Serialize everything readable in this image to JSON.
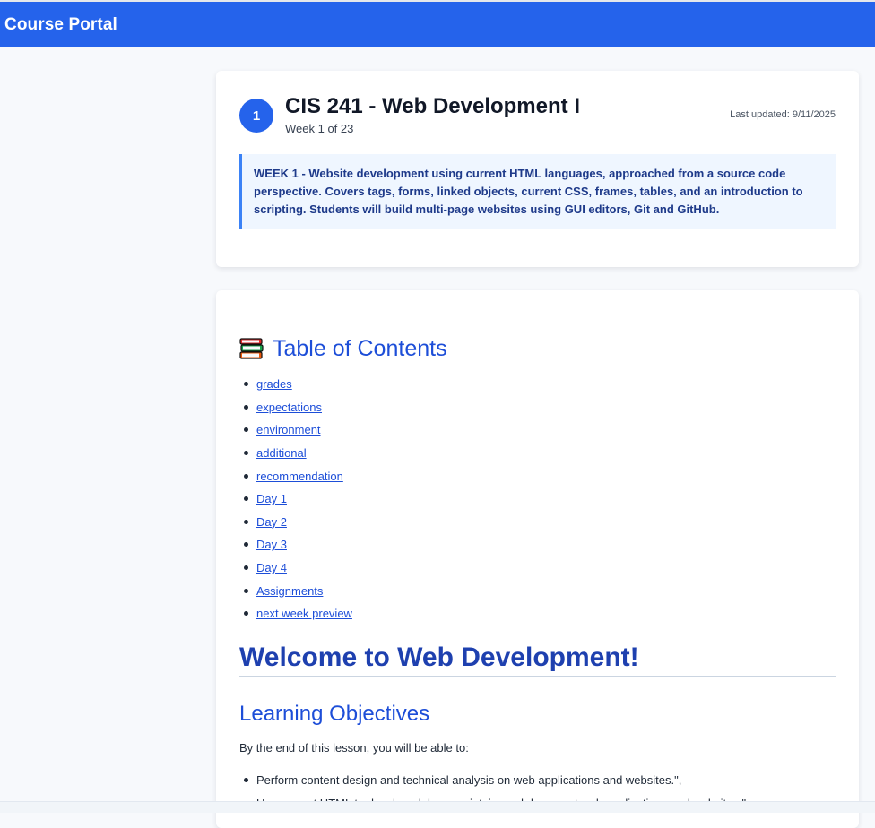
{
  "app": {
    "title": "Course Portal"
  },
  "course": {
    "week_number": "1",
    "title": "CIS 241 - Web Development I",
    "week_label": "Week 1 of 23",
    "last_updated": "Last updated: 9/11/2025",
    "description": "WEEK 1 - Website development using current HTML languages, approached from a source code perspective. Covers tags, forms, linked objects, current CSS, frames, tables, and an introduction to scripting. Students will build multi-page websites using GUI editors, Git and GitHub."
  },
  "toc": {
    "heading": "Table of Contents",
    "icon": "books-icon",
    "items": [
      {
        "label": "grades"
      },
      {
        "label": "expectations"
      },
      {
        "label": "environment"
      },
      {
        "label": "additional"
      },
      {
        "label": "recommendation"
      },
      {
        "label": "Day 1"
      },
      {
        "label": "Day 2"
      },
      {
        "label": "Day 3"
      },
      {
        "label": "Day 4"
      },
      {
        "label": "Assignments"
      },
      {
        "label": "next week preview"
      }
    ]
  },
  "content": {
    "welcome_heading": "Welcome to Web Development!",
    "objectives_heading": "Learning Objectives",
    "objectives_intro": "By the end of this lesson, you will be able to:",
    "objectives": [
      "Perform content design and technical analysis on web applications and websites.\",",
      "Use current HTML to develop, debug, maintain, and document web applications and websites.\""
    ]
  },
  "colors": {
    "header": "#2563eb",
    "accent": "#1d4ed8",
    "description_bg": "#eff6ff",
    "description_border": "#3b82f6"
  }
}
